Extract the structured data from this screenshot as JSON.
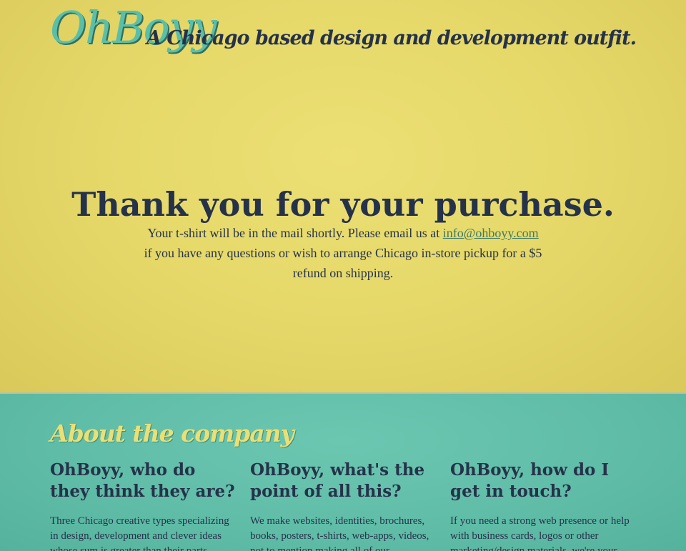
{
  "header": {
    "logo": "OhBoyy",
    "tagline": "A Chicago based design and development outfit."
  },
  "main": {
    "heading": "Thank you for your purchase.",
    "message_before": "Your t-shirt will be in the mail shortly. Please email us at ",
    "email_link": "info@ohboyy.com",
    "message_after": " if you have any questions or wish to arrange Chicago in-store pickup for a $5 refund on shipping."
  },
  "about": {
    "heading": "About the company",
    "columns": [
      {
        "title": "OhBoyy, who do they think they are?",
        "text": "Three Chicago creative types specializing in design, development and clever ideas whose sum is greater than their parts."
      },
      {
        "title": "OhBoyy, what's the point of all this?",
        "text": "We make websites, identities, brochures, books, posters, t-shirts, web-apps, videos, not to mention making all of our"
      },
      {
        "title": "OhBoyy, how do I get in touch?",
        "text": "If you need a strong web presence or help with business cards, logos or other marketing/design materials, we're your"
      }
    ]
  },
  "colors": {
    "hero_background": "#e6d96a",
    "company_background": "#5fbca6",
    "text_dark": "#26324a",
    "logo_teal": "#5bbfa8",
    "accent_yellow": "#ecdf74",
    "link": "#3f7a64"
  }
}
